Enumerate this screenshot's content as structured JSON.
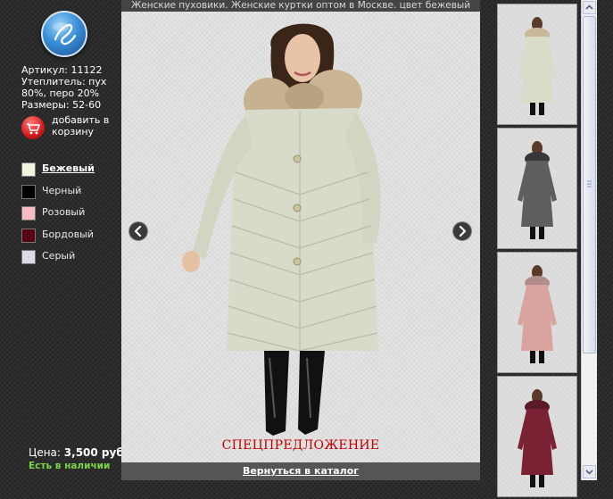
{
  "product": {
    "title": "Женские пуховики. Женские куртки оптом в Москве. цвет бежевый",
    "article": "Артикул: 11122",
    "insulation": "Утеплитель: пух 80%, перо 20%",
    "sizes": "Размеры: 52-60",
    "price_label": "Цена:",
    "price_value": "3,500 руб.",
    "availability": "Есть в наличии",
    "promo": "СПЕЦПРЕДЛОЖЕНИЕ"
  },
  "cart": {
    "label": "добавить в корзину"
  },
  "colors": [
    {
      "label": "Бежевый",
      "hex": "#f2f3dc",
      "active": true
    },
    {
      "label": "Черный",
      "hex": "#000000",
      "active": false
    },
    {
      "label": "Розовый",
      "hex": "#f7bcc2",
      "active": false
    },
    {
      "label": "Бордовый",
      "hex": "#5a0015",
      "active": false
    },
    {
      "label": "Серый",
      "hex": "#dcdce6",
      "active": false
    }
  ],
  "navigation": {
    "back_to_catalog": "Вернуться в каталог"
  },
  "thumbnails": [
    {
      "coat_color": "#d9dcc8",
      "fur_color": "#c9b89a"
    },
    {
      "coat_color": "#5e5e60",
      "fur_color": "#3a3638"
    },
    {
      "coat_color": "#d9a3a0",
      "fur_color": "#b08c8a"
    },
    {
      "coat_color": "#7a2233",
      "fur_color": "#5a1a28"
    }
  ],
  "icons": {
    "logo": "logo-icon",
    "cart": "shopping-cart-icon",
    "prev": "chevron-left-icon",
    "next": "chevron-right-icon"
  }
}
